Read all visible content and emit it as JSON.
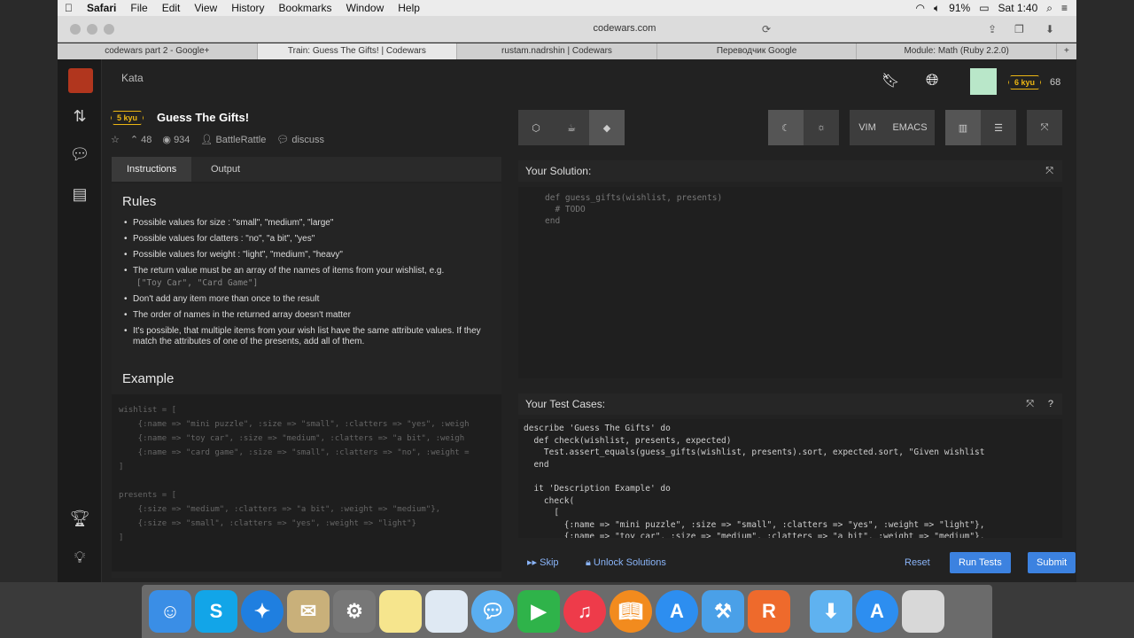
{
  "menubar": {
    "apple": "",
    "app": "Safari",
    "items": [
      "File",
      "Edit",
      "View",
      "History",
      "Bookmarks",
      "Window",
      "Help"
    ],
    "battery": "91%",
    "time": "Sat 1:40"
  },
  "browser": {
    "url": "codewars.com",
    "tabs": [
      {
        "label": "codewars part 2 - Google+"
      },
      {
        "label": "Train: Guess The Gifts! | Codewars",
        "active": true
      },
      {
        "label": "rustam.nadrshin | Codewars"
      },
      {
        "label": "Переводчик Google"
      },
      {
        "label": "Module: Math (Ruby 2.2.0)"
      }
    ],
    "new_tab": "+"
  },
  "topbar": {
    "kata_link": "Kata",
    "rank": "6 kyu",
    "honor": "68"
  },
  "kata": {
    "rank": "5 kyu",
    "title": "Guess The Gifts!",
    "votes": "48",
    "solved": "934",
    "author": "BattleRattle",
    "discuss": "discuss"
  },
  "desc_tabs": {
    "instructions": "Instructions",
    "output": "Output"
  },
  "rules": {
    "heading": "Rules",
    "items": [
      "Possible values for  size : \"small\", \"medium\", \"large\"",
      "Possible values for  clatters : \"no\", \"a bit\", \"yes\"",
      "Possible values for  weight : \"light\", \"medium\", \"heavy\"",
      "The return value must be an array of the names of items from your wishlist, e.g.",
      "Don't add any item more than once to the result",
      "The order of names in the returned array doesn't matter",
      "It's possible, that multiple items from your wish list have the same attribute values. If they match the attributes of one of the presents, add all of them."
    ],
    "example_return": "[\"Toy Car\", \"Card Game\"]"
  },
  "example": {
    "heading": "Example",
    "code": "wishlist = [\n    {:name => \"mini puzzle\", :size => \"small\", :clatters => \"yes\", :weigh\n    {:name => \"toy car\", :size => \"medium\", :clatters => \"a bit\", :weigh\n    {:name => \"card game\", :size => \"small\", :clatters => \"no\", :weight =\n]\n\npresents = [\n    {:size => \"medium\", :clatters => \"a bit\", :weight => \"medium\"},\n    {:size => \"small\", :clatters => \"yes\", :weight => \"light\"}\n]"
  },
  "editor": {
    "vim": "VIM",
    "emacs": "EMACS",
    "solution_label": "Your Solution:",
    "solution_code": "def guess_gifts(wishlist, presents)\n  # TODO\nend",
    "tests_label": "Your Test Cases:",
    "tests_code": "describe 'Guess The Gifts' do\n  def check(wishlist, presents, expected)\n    Test.assert_equals(guess_gifts(wishlist, presents).sort, expected.sort, \"Given wishlist\n  end\n\n  it 'Description Example' do\n    check(\n      [\n        {:name => \"mini puzzle\", :size => \"small\", :clatters => \"yes\", :weight => \"light\"},\n        {:name => \"toy car\", :size => \"medium\", :clatters => \"a bit\", :weight => \"medium\"},"
  },
  "actions": {
    "skip": "Skip",
    "unlock": "Unlock Solutions",
    "reset": "Reset",
    "run": "Run Tests",
    "submit": "Submit"
  },
  "colors": {
    "accent": "#3c82e0",
    "rank": "#ecb613",
    "logo": "#b1361e"
  }
}
